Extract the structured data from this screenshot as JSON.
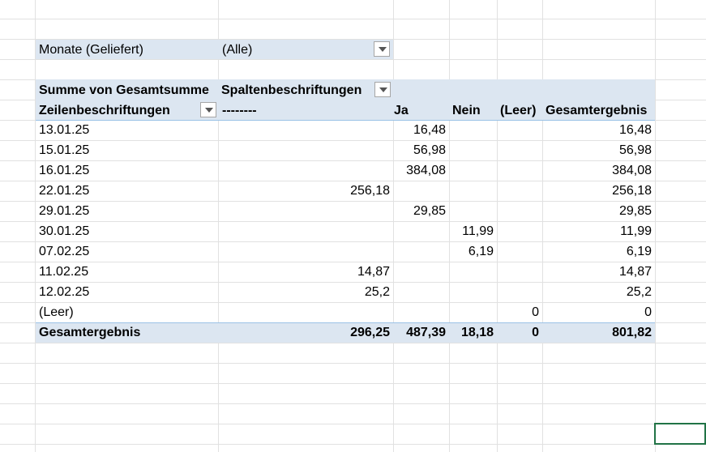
{
  "filter": {
    "label": "Monate (Geliefert)",
    "value": "(Alle)"
  },
  "pivot": {
    "value_header": "Summe von Gesamtsumme",
    "col_labels_header": "Spaltenbeschriftungen",
    "row_labels_header": "Zeilenbeschriftungen",
    "columns": [
      "--------",
      "Ja",
      "Nein",
      "(Leer)",
      "Gesamtergebnis"
    ],
    "rows": [
      {
        "label": "13.01.25",
        "values": [
          "",
          "16,48",
          "",
          "",
          "16,48"
        ]
      },
      {
        "label": "15.01.25",
        "values": [
          "",
          "56,98",
          "",
          "",
          "56,98"
        ]
      },
      {
        "label": "16.01.25",
        "values": [
          "",
          "384,08",
          "",
          "",
          "384,08"
        ]
      },
      {
        "label": "22.01.25",
        "values": [
          "256,18",
          "",
          "",
          "",
          "256,18"
        ]
      },
      {
        "label": "29.01.25",
        "values": [
          "",
          "29,85",
          "",
          "",
          "29,85"
        ]
      },
      {
        "label": "30.01.25",
        "values": [
          "",
          "",
          "11,99",
          "",
          "11,99"
        ]
      },
      {
        "label": "07.02.25",
        "values": [
          "",
          "",
          "6,19",
          "",
          "6,19"
        ]
      },
      {
        "label": "11.02.25",
        "values": [
          "14,87",
          "",
          "",
          "",
          "14,87"
        ]
      },
      {
        "label": "12.02.25",
        "values": [
          "25,2",
          "",
          "",
          "",
          "25,2"
        ]
      },
      {
        "label": "(Leer)",
        "values": [
          "",
          "",
          "",
          "0",
          "0"
        ]
      }
    ],
    "total": {
      "label": "Gesamtergebnis",
      "values": [
        "296,25",
        "487,39",
        "18,18",
        "0",
        "801,82"
      ]
    }
  }
}
